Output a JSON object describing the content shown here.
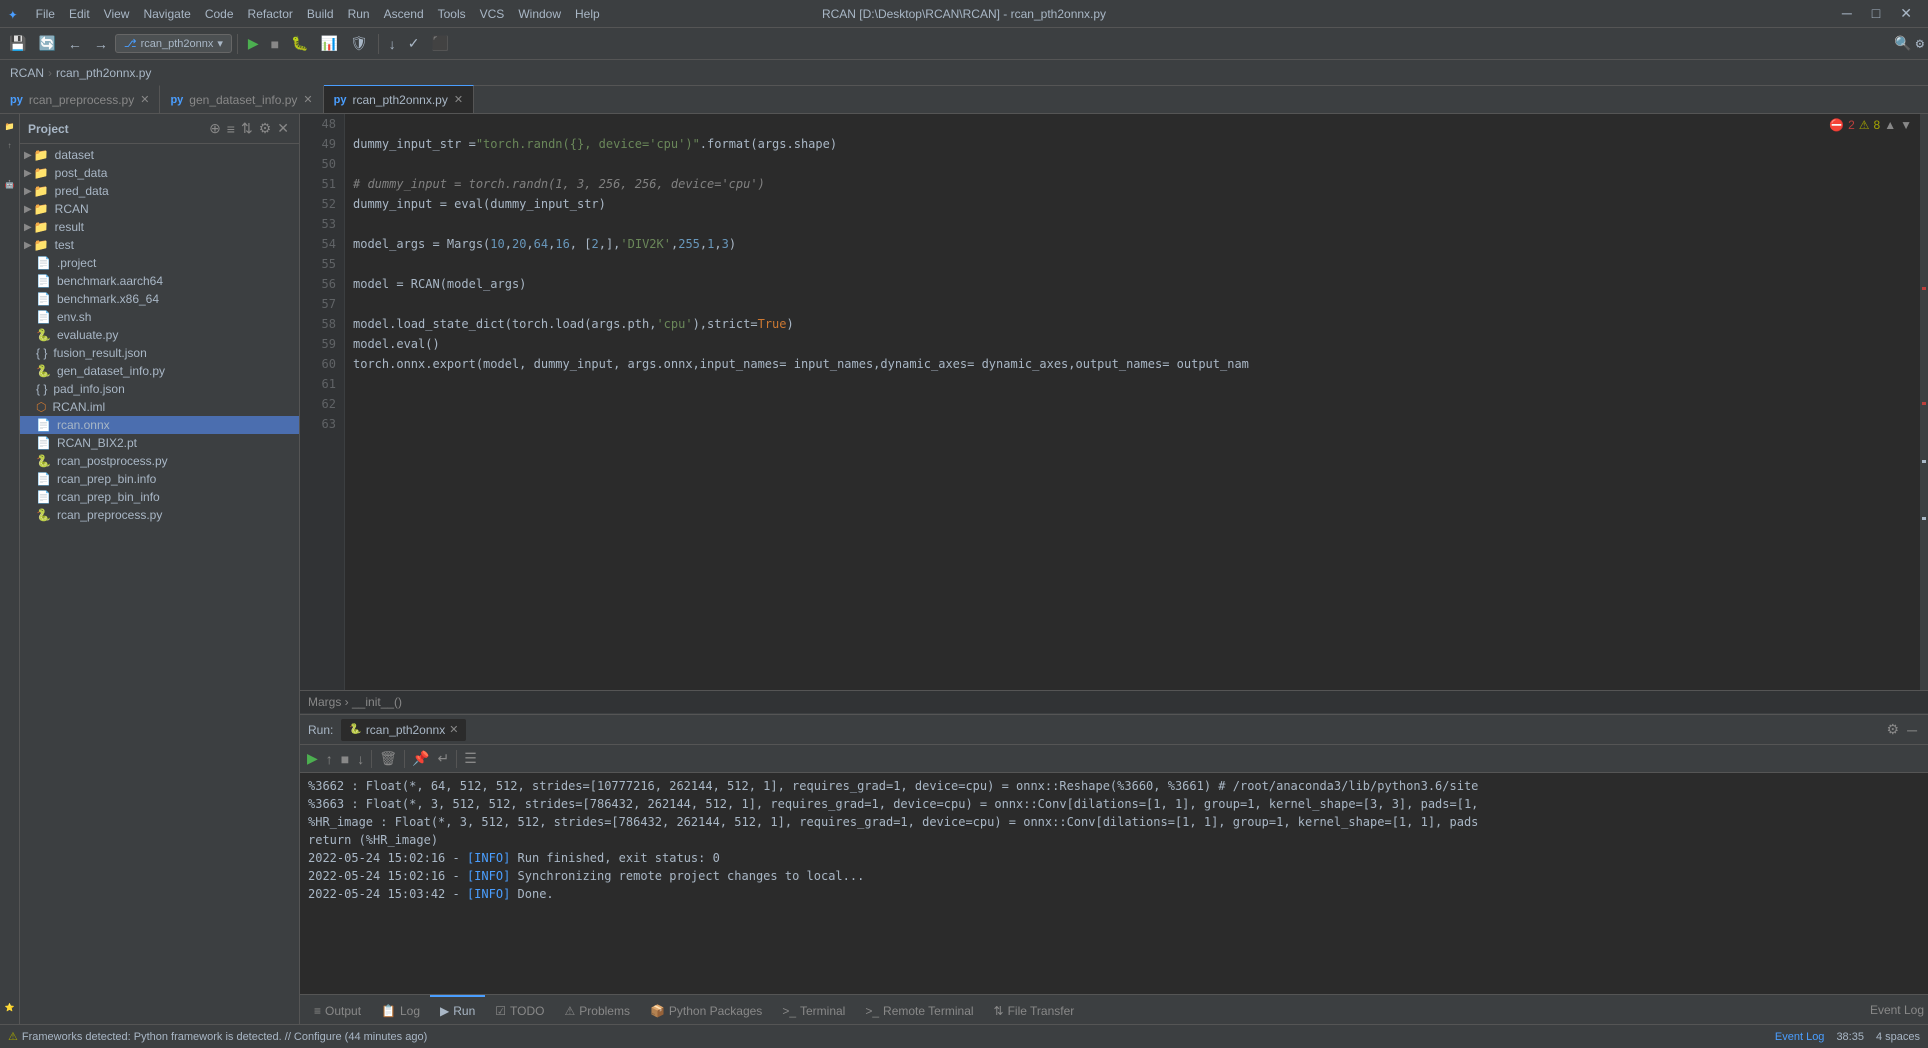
{
  "titlebar": {
    "title": "RCAN [D:\\Desktop\\RCAN\\RCAN] - rcan_pth2onnx.py",
    "menu_items": [
      "File",
      "Edit",
      "View",
      "Navigate",
      "Code",
      "Refactor",
      "Build",
      "Run",
      "Ascend",
      "Tools",
      "VCS",
      "Window",
      "Help"
    ],
    "controls": [
      "─",
      "□",
      "✕"
    ]
  },
  "toolbar": {
    "branch": "rcan_pth2onnx",
    "branch_icon": "▶"
  },
  "breadcrumb": {
    "project": "RCAN",
    "file": "rcan_pth2onnx.py"
  },
  "tabs": [
    {
      "label": "rcan_preprocess.py",
      "icon": "py",
      "active": false
    },
    {
      "label": "gen_dataset_info.py",
      "icon": "py",
      "active": false
    },
    {
      "label": "rcan_pth2onnx.py",
      "icon": "py",
      "active": true
    }
  ],
  "file_tree": {
    "root": "Project",
    "items": [
      {
        "indent": 0,
        "type": "folder",
        "label": "dataset",
        "expanded": false
      },
      {
        "indent": 0,
        "type": "folder",
        "label": "post_data",
        "expanded": false
      },
      {
        "indent": 0,
        "type": "folder",
        "label": "pred_data",
        "expanded": false
      },
      {
        "indent": 0,
        "type": "folder",
        "label": "RCAN",
        "expanded": false
      },
      {
        "indent": 0,
        "type": "folder",
        "label": "result",
        "expanded": false
      },
      {
        "indent": 0,
        "type": "folder",
        "label": "test",
        "expanded": false
      },
      {
        "indent": 0,
        "type": "file",
        "label": ".project",
        "icon": "config"
      },
      {
        "indent": 0,
        "type": "file",
        "label": "benchmark.aarch64",
        "icon": "txt"
      },
      {
        "indent": 0,
        "type": "file",
        "label": "benchmark.x86_64",
        "icon": "txt"
      },
      {
        "indent": 0,
        "type": "file",
        "label": "env.sh",
        "icon": "sh"
      },
      {
        "indent": 0,
        "type": "file",
        "label": "evaluate.py",
        "icon": "py"
      },
      {
        "indent": 0,
        "type": "file",
        "label": "fusion_result.json",
        "icon": "json"
      },
      {
        "indent": 0,
        "type": "file",
        "label": "gen_dataset_info.py",
        "icon": "py"
      },
      {
        "indent": 0,
        "type": "file",
        "label": "pad_info.json",
        "icon": "json"
      },
      {
        "indent": 0,
        "type": "file",
        "label": "RCAN.iml",
        "icon": "iml"
      },
      {
        "indent": 0,
        "type": "file",
        "label": "rcan.onnx",
        "icon": "onnx",
        "selected": true
      },
      {
        "indent": 0,
        "type": "file",
        "label": "RCAN_BIX2.pt",
        "icon": "txt"
      },
      {
        "indent": 0,
        "type": "file",
        "label": "rcan_postprocess.py",
        "icon": "py"
      },
      {
        "indent": 0,
        "type": "file",
        "label": "rcan_prep_bin.info",
        "icon": "info"
      },
      {
        "indent": 0,
        "type": "file",
        "label": "rcan_prep_bin_info",
        "icon": "txt"
      },
      {
        "indent": 0,
        "type": "file",
        "label": "rcan_preprocess.py",
        "icon": "py"
      }
    ]
  },
  "code": {
    "lines": [
      {
        "num": 48,
        "content": ""
      },
      {
        "num": 49,
        "tokens": [
          {
            "t": "plain",
            "v": "        dummy_input_str = "
          },
          {
            "t": "str",
            "v": "\"torch.randn({}, device='cpu')\""
          },
          {
            "t": "plain",
            "v": ".format(args.shape)"
          }
        ]
      },
      {
        "num": 50,
        "content": ""
      },
      {
        "num": 51,
        "tokens": [
          {
            "t": "comment",
            "v": "        # dummy_input = torch.randn(1, 3, 256, 256, device='cpu')"
          }
        ]
      },
      {
        "num": 52,
        "tokens": [
          {
            "t": "plain",
            "v": "        dummy_input = eval(dummy_input_str)"
          }
        ]
      },
      {
        "num": 53,
        "content": ""
      },
      {
        "num": 54,
        "tokens": [
          {
            "t": "plain",
            "v": "        model_args = Margs("
          },
          {
            "t": "num",
            "v": "10"
          },
          {
            "t": "plain",
            "v": ", "
          },
          {
            "t": "num",
            "v": "20"
          },
          {
            "t": "plain",
            "v": ", "
          },
          {
            "t": "num",
            "v": "64"
          },
          {
            "t": "plain",
            "v": ", "
          },
          {
            "t": "num",
            "v": "16"
          },
          {
            "t": "plain",
            "v": ", ["
          },
          {
            "t": "num",
            "v": "2"
          },
          {
            "t": "plain",
            "v": ",], "
          },
          {
            "t": "str",
            "v": "'DIV2K'"
          },
          {
            "t": "plain",
            "v": ", "
          },
          {
            "t": "num",
            "v": "255"
          },
          {
            "t": "plain",
            "v": ", "
          },
          {
            "t": "num",
            "v": "1"
          },
          {
            "t": "plain",
            "v": ", "
          },
          {
            "t": "num",
            "v": "3"
          },
          {
            "t": "plain",
            "v": ")"
          }
        ]
      },
      {
        "num": 55,
        "content": ""
      },
      {
        "num": 56,
        "tokens": [
          {
            "t": "plain",
            "v": "        model = RCAN(model_args)"
          }
        ]
      },
      {
        "num": 57,
        "content": ""
      },
      {
        "num": 58,
        "tokens": [
          {
            "t": "plain",
            "v": "        model.load_state_dict(torch.load(args.pth, "
          },
          {
            "t": "str",
            "v": "'cpu'"
          },
          {
            "t": "plain",
            "v": "),strict="
          },
          {
            "t": "kw",
            "v": "True"
          },
          {
            "t": "plain",
            "v": ")"
          }
        ]
      },
      {
        "num": 59,
        "tokens": [
          {
            "t": "plain",
            "v": "        model.eval()"
          }
        ]
      },
      {
        "num": 60,
        "tokens": [
          {
            "t": "plain",
            "v": "        torch.onnx.export(model, dummy_input, args.onnx, "
          },
          {
            "t": "plain",
            "v": "input_names"
          },
          {
            "t": "plain",
            "v": " = input_names, "
          },
          {
            "t": "plain",
            "v": "dynamic_axes"
          },
          {
            "t": "plain",
            "v": " = dynamic_axes, "
          },
          {
            "t": "plain",
            "v": "output_names"
          },
          {
            "t": "plain",
            "v": " = output_nam"
          }
        ]
      },
      {
        "num": 61,
        "content": ""
      },
      {
        "num": 62,
        "content": ""
      },
      {
        "num": 63,
        "content": ""
      }
    ],
    "breadcrumb": "Margs › __init__()",
    "error_count": "2",
    "warn_count": "8"
  },
  "run_panel": {
    "label": "Run:",
    "tab_label": "rcan_pth2onnx",
    "output_lines": [
      "%3662 : Float(*, 64, 512, 512, strides=[10777216, 262144, 512, 1], requires_grad=1, device=cpu) = onnx::Reshape(%3660, %3661) # /root/anaconda3/lib/python3.6/site",
      "%3663 : Float(*, 3, 512, 512, strides=[786432, 262144, 512, 1], requires_grad=1, device=cpu) = onnx::Conv[dilations=[1, 1], group=1, kernel_shape=[3, 3], pads=[1,",
      "%HR_image : Float(*, 3, 512, 512, strides=[786432, 262144, 512, 1], requires_grad=1, device=cpu) = onnx::Conv[dilations=[1, 1], group=1, kernel_shape=[1, 1], pads",
      "return (%HR_image)",
      "",
      "2022-05-24 15:02:16 - [INFO] Run finished, exit status: 0",
      "2022-05-24 15:02:16 - [INFO] Synchronizing remote project changes to local...",
      "2022-05-24 15:03:42 - [INFO] Done."
    ]
  },
  "bottom_tabs": [
    {
      "label": "Output",
      "icon": "≡",
      "active": false
    },
    {
      "label": "Log",
      "icon": "📋",
      "active": false
    },
    {
      "label": "Run",
      "icon": "▶",
      "active": true
    },
    {
      "label": "TODO",
      "icon": "☑",
      "active": false
    },
    {
      "label": "Problems",
      "icon": "⚠",
      "active": false
    },
    {
      "label": "Python Packages",
      "icon": "📦",
      "active": false
    },
    {
      "label": "Terminal",
      "icon": ">_",
      "active": false
    },
    {
      "label": "Remote Terminal",
      "icon": ">_",
      "active": false
    },
    {
      "label": "File Transfer",
      "icon": "⇅",
      "active": false
    }
  ],
  "status_bar": {
    "message": "Frameworks detected: Python framework is detected. // Configure (44 minutes ago)",
    "time": "38:35",
    "spaces": "4 spaces",
    "event_log": "Event Log"
  },
  "sidebar_vert_tabs": [
    "Project",
    "Commit",
    "Automl Tasks",
    "Favorites"
  ]
}
